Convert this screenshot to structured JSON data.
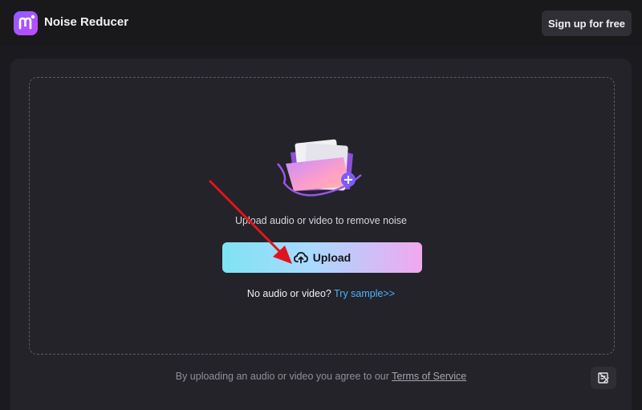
{
  "header": {
    "app_title": "Noise Reducer",
    "signup_label": "Sign up for free",
    "logo_icon": "m-logo-icon"
  },
  "dropzone": {
    "hint": "Upload audio or video to remove noise",
    "upload_label": "Upload",
    "upload_icon": "cloud-upload-icon",
    "sample_prefix": "No audio or video?",
    "sample_link": "Try sample>>"
  },
  "footer": {
    "terms_prefix": "By uploading an audio or video you agree to our",
    "terms_link": "Terms of Service",
    "feedback_icon": "feedback-icon"
  },
  "colors": {
    "background": "#1b1b1f",
    "panel": "#232329",
    "accent_link": "#4fb2ff",
    "annotation_arrow": "#e0141e"
  }
}
